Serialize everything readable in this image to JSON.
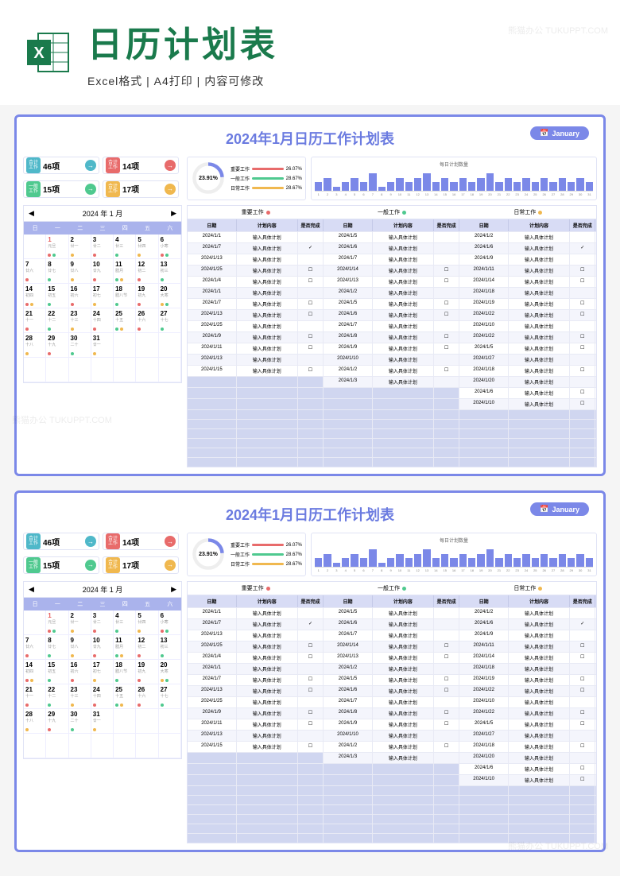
{
  "watermark": "熊猫办公 TUKUPPT.COM",
  "banner": {
    "title": "日历计划表",
    "subtitle": "Excel格式 | A4打印 | 内容可修改"
  },
  "sheet": {
    "title": "2024年1月日历工作计划表",
    "month_label": "January",
    "kpi": [
      {
        "label": "合计工作",
        "value": "46项",
        "bg": "#4fb8c9",
        "arrow_bg": "#4fb8c9"
      },
      {
        "label": "合计工作",
        "value": "14项",
        "bg": "#e86b6b",
        "arrow_bg": "#e86b6b"
      },
      {
        "label": "一般工作",
        "value": "15项",
        "bg": "#4fc98f",
        "arrow_bg": "#4fc98f"
      },
      {
        "label": "合计工作",
        "value": "17项",
        "bg": "#f0b84f",
        "arrow_bg": "#f0b84f"
      }
    ],
    "gauge": {
      "percent": "23.91%",
      "legend": [
        {
          "label": "重要工作",
          "pct": "26.07%",
          "color": "#e86b6b"
        },
        {
          "label": "一般工作",
          "pct": "28.67%",
          "color": "#4fc98f"
        },
        {
          "label": "日常工作",
          "pct": "28.67%",
          "color": "#f0b84f"
        }
      ]
    },
    "chart_data": {
      "type": "bar",
      "title": "每日计划数量",
      "categories": [
        "1",
        "2",
        "3",
        "4",
        "5",
        "6",
        "7",
        "8",
        "9",
        "10",
        "11",
        "12",
        "13",
        "14",
        "15",
        "16",
        "17",
        "18",
        "19",
        "20",
        "21",
        "22",
        "23",
        "24",
        "25",
        "26",
        "27",
        "28",
        "29",
        "30",
        "31"
      ],
      "values": [
        2,
        3,
        1,
        2,
        3,
        2,
        4,
        1,
        2,
        3,
        2,
        3,
        4,
        2,
        3,
        2,
        3,
        2,
        3,
        4,
        2,
        3,
        2,
        3,
        2,
        3,
        2,
        3,
        2,
        3,
        2
      ],
      "ylim": [
        0,
        5
      ]
    },
    "calendar": {
      "year": "2024",
      "year_suffix": "年",
      "month": "1",
      "month_suffix": "月",
      "dow": [
        "日",
        "一",
        "二",
        "三",
        "四",
        "五",
        "六"
      ],
      "cells": [
        {
          "d": "",
          "l": ""
        },
        {
          "d": "1",
          "l": "元旦",
          "hol": true,
          "dots": [
            "#e86b6b",
            "#4fc98f"
          ]
        },
        {
          "d": "2",
          "l": "廿一",
          "dots": [
            "#f0b84f"
          ]
        },
        {
          "d": "3",
          "l": "廿二",
          "dots": [
            "#e86b6b"
          ]
        },
        {
          "d": "4",
          "l": "廿三",
          "dots": [
            "#4fc98f"
          ]
        },
        {
          "d": "5",
          "l": "廿四",
          "dots": [
            "#f0b84f"
          ]
        },
        {
          "d": "6",
          "l": "小寒",
          "dots": [
            "#e86b6b",
            "#4fc98f"
          ]
        },
        {
          "d": "7",
          "l": "廿六",
          "dots": [
            "#e86b6b"
          ]
        },
        {
          "d": "8",
          "l": "廿七",
          "dots": [
            "#4fc98f"
          ]
        },
        {
          "d": "9",
          "l": "廿八",
          "dots": [
            "#f0b84f"
          ]
        },
        {
          "d": "10",
          "l": "廿九",
          "dots": [
            "#e86b6b"
          ]
        },
        {
          "d": "11",
          "l": "腊月",
          "dots": [
            "#4fc98f",
            "#f0b84f"
          ]
        },
        {
          "d": "12",
          "l": "初二",
          "dots": [
            "#e86b6b"
          ]
        },
        {
          "d": "13",
          "l": "初三",
          "dots": [
            "#4fc98f"
          ]
        },
        {
          "d": "14",
          "l": "初四",
          "dots": [
            "#e86b6b",
            "#f0b84f"
          ]
        },
        {
          "d": "15",
          "l": "初五",
          "dots": [
            "#4fc98f"
          ]
        },
        {
          "d": "16",
          "l": "初六",
          "dots": [
            "#e86b6b"
          ]
        },
        {
          "d": "17",
          "l": "初七",
          "dots": [
            "#f0b84f"
          ]
        },
        {
          "d": "18",
          "l": "腊八节",
          "dots": [
            "#4fc98f"
          ]
        },
        {
          "d": "19",
          "l": "初九",
          "dots": [
            "#e86b6b"
          ]
        },
        {
          "d": "20",
          "l": "大寒",
          "dots": [
            "#f0b84f",
            "#4fc98f"
          ]
        },
        {
          "d": "21",
          "l": "十一",
          "dots": [
            "#e86b6b"
          ]
        },
        {
          "d": "22",
          "l": "十二",
          "dots": [
            "#4fc98f"
          ]
        },
        {
          "d": "23",
          "l": "十三",
          "dots": [
            "#f0b84f"
          ]
        },
        {
          "d": "24",
          "l": "十四",
          "dots": [
            "#e86b6b"
          ]
        },
        {
          "d": "25",
          "l": "十五",
          "dots": [
            "#4fc98f",
            "#f0b84f"
          ]
        },
        {
          "d": "26",
          "l": "十六",
          "dots": [
            "#e86b6b"
          ]
        },
        {
          "d": "27",
          "l": "十七",
          "dots": [
            "#4fc98f"
          ]
        },
        {
          "d": "28",
          "l": "十八",
          "dots": [
            "#f0b84f"
          ]
        },
        {
          "d": "29",
          "l": "十九",
          "dots": [
            "#e86b6b"
          ]
        },
        {
          "d": "30",
          "l": "二十",
          "dots": [
            "#4fc98f"
          ]
        },
        {
          "d": "31",
          "l": "廿一",
          "dots": [
            "#f0b84f"
          ]
        },
        {
          "d": "",
          "l": ""
        },
        {
          "d": "",
          "l": ""
        },
        {
          "d": "",
          "l": ""
        },
        {
          "d": "",
          "l": ""
        },
        {
          "d": "",
          "l": ""
        },
        {
          "d": "",
          "l": ""
        },
        {
          "d": "",
          "l": ""
        },
        {
          "d": "",
          "l": ""
        },
        {
          "d": "",
          "l": ""
        },
        {
          "d": "",
          "l": ""
        }
      ]
    },
    "task_sections": [
      {
        "label": "重要工作",
        "color": "#e86b6b"
      },
      {
        "label": "一般工作",
        "color": "#4fc98f"
      },
      {
        "label": "日常工作",
        "color": "#f0b84f"
      }
    ],
    "task_headers": [
      "日期",
      "计划内容",
      "是否完成",
      "日期",
      "计划内容",
      "是否完成",
      "日期",
      "计划内容",
      "是否完成"
    ],
    "task_rows": [
      {
        "cells": [
          "2024/1/1",
          "输入具体计划",
          "",
          "2024/1/5",
          "输入具体计划",
          "",
          "2024/1/2",
          "输入具体计划",
          ""
        ]
      },
      {
        "cells": [
          "2024/1/7",
          "输入具体计划",
          "✓",
          "2024/1/6",
          "输入具体计划",
          "",
          "2024/1/6",
          "输入具体计划",
          "✓"
        ]
      },
      {
        "cells": [
          "2024/1/13",
          "输入具体计划",
          "",
          "2024/1/7",
          "输入具体计划",
          "",
          "2024/1/9",
          "输入具体计划",
          ""
        ]
      },
      {
        "cells": [
          "2024/1/25",
          "输入具体计划",
          "☐",
          "2024/1/14",
          "输入具体计划",
          "☐",
          "2024/1/11",
          "输入具体计划",
          "☐"
        ]
      },
      {
        "cells": [
          "2024/1/4",
          "输入具体计划",
          "☐",
          "2024/1/13",
          "输入具体计划",
          "☐",
          "2024/1/14",
          "输入具体计划",
          "☐"
        ]
      },
      {
        "cells": [
          "2024/1/1",
          "输入具体计划",
          "",
          "2024/1/2",
          "输入具体计划",
          "",
          "2024/1/18",
          "输入具体计划",
          ""
        ]
      },
      {
        "cells": [
          "2024/1/7",
          "输入具体计划",
          "☐",
          "2024/1/5",
          "输入具体计划",
          "☐",
          "2024/1/19",
          "输入具体计划",
          "☐"
        ]
      },
      {
        "cells": [
          "2024/1/13",
          "输入具体计划",
          "☐",
          "2024/1/6",
          "输入具体计划",
          "☐",
          "2024/1/22",
          "输入具体计划",
          "☐"
        ]
      },
      {
        "cells": [
          "2024/1/25",
          "输入具体计划",
          "",
          "2024/1/7",
          "输入具体计划",
          "",
          "2024/1/10",
          "输入具体计划",
          ""
        ]
      },
      {
        "cells": [
          "2024/1/9",
          "输入具体计划",
          "☐",
          "2024/1/8",
          "输入具体计划",
          "☐",
          "2024/1/22",
          "输入具体计划",
          "☐"
        ]
      },
      {
        "cells": [
          "2024/1/11",
          "输入具体计划",
          "☐",
          "2024/1/9",
          "输入具体计划",
          "☐",
          "2024/1/5",
          "输入具体计划",
          "☐"
        ]
      },
      {
        "cells": [
          "2024/1/13",
          "输入具体计划",
          "",
          "2024/1/10",
          "输入具体计划",
          "",
          "2024/1/27",
          "输入具体计划",
          ""
        ]
      },
      {
        "cells": [
          "2024/1/15",
          "输入具体计划",
          "☐",
          "2024/1/2",
          "输入具体计划",
          "☐",
          "2024/1/18",
          "输入具体计划",
          "☐"
        ]
      },
      {
        "cells": [
          "",
          "",
          "☐",
          "2024/1/3",
          "输入具体计划",
          "",
          "2024/1/20",
          "输入具体计划",
          ""
        ],
        "empty1": true
      },
      {
        "cells": [
          "",
          "",
          "☐",
          "",
          "",
          "☐",
          "2024/1/6",
          "输入具体计划",
          "☐"
        ],
        "empty2": true
      },
      {
        "cells": [
          "",
          "",
          "☐",
          "",
          "",
          "☐",
          "2024/1/10",
          "输入具体计划",
          "☐"
        ],
        "empty2": true
      },
      {
        "cells": [
          "",
          "",
          "☐",
          "",
          "",
          "☐",
          "",
          "",
          "☐"
        ],
        "empty3": true
      },
      {
        "cells": [
          "",
          "",
          "☐",
          "",
          "",
          "☐",
          "",
          "",
          "☐"
        ],
        "empty3": true
      },
      {
        "cells": [
          "",
          "",
          "☐",
          "",
          "",
          "☐",
          "",
          "",
          "☐"
        ],
        "empty3": true
      },
      {
        "cells": [
          "",
          "",
          "☐",
          "",
          "",
          "☐",
          "",
          "",
          "☐"
        ],
        "empty3": true
      },
      {
        "cells": [
          "",
          "",
          "☐",
          "",
          "",
          "☐",
          "",
          "",
          "☐"
        ],
        "empty3": true
      },
      {
        "cells": [
          "",
          "",
          "☐",
          "",
          "",
          "☐",
          "",
          "",
          "☐"
        ],
        "empty3": true
      }
    ]
  }
}
